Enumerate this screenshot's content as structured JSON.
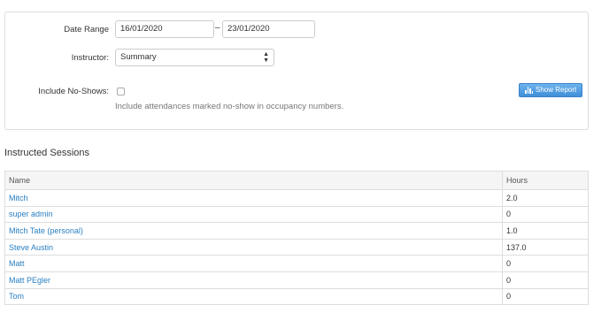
{
  "filters": {
    "date_range_label": "Date Range",
    "date_from": "16/01/2020",
    "date_separator": "–",
    "date_to": "23/01/2020",
    "instructor_label": "Instructor:",
    "instructor_selected": "Summary",
    "include_no_shows_label": "Include No-Shows:",
    "include_no_shows_checked": false,
    "include_no_shows_help": "Include attendances marked no-show in occupancy numbers.",
    "show_report_label": "Show Report",
    "show_report_icon": "bar-chart-icon"
  },
  "sessions": {
    "title": "Instructed Sessions",
    "columns": [
      "Name",
      "Hours"
    ],
    "rows": [
      {
        "name": "Mitch",
        "hours": "2.0"
      },
      {
        "name": "super admin",
        "hours": "0"
      },
      {
        "name": "Mitch Tate (personal)",
        "hours": "1.0"
      },
      {
        "name": "Steve Austin",
        "hours": "137.0"
      },
      {
        "name": "Matt",
        "hours": "0"
      },
      {
        "name": "Matt PEgler",
        "hours": "0"
      },
      {
        "name": "Tom",
        "hours": "0"
      }
    ]
  }
}
